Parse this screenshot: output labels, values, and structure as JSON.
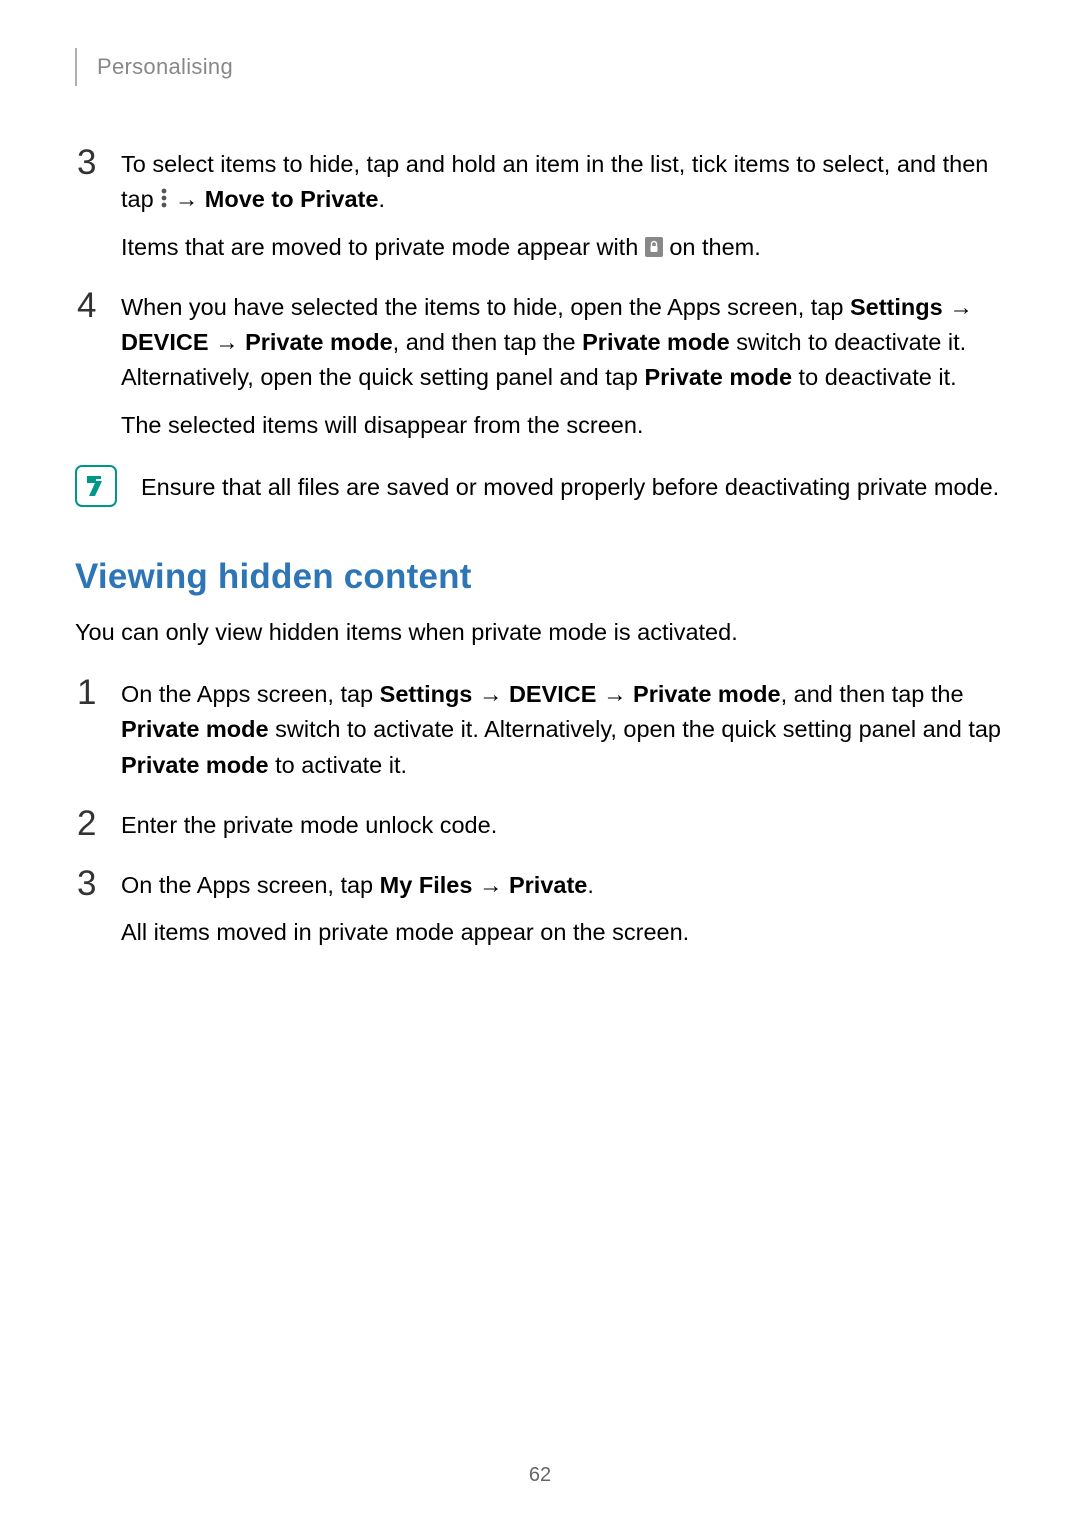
{
  "header": {
    "title": "Personalising"
  },
  "block1": {
    "step3": {
      "num": "3",
      "p1_a": "To select items to hide, tap and hold an item in the list, tick items to select, and then tap ",
      "p1_b": " → ",
      "p1_c": "Move to Private",
      "p1_d": ".",
      "p2_a": "Items that are moved to private mode appear with ",
      "p2_b": " on them."
    },
    "step4": {
      "num": "4",
      "p1_a": "When you have selected the items to hide, open the Apps screen, tap ",
      "p1_b": "Settings",
      "p1_c": " → ",
      "p1_d": "DEVICE",
      "p1_e": " → ",
      "p1_f": "Private mode",
      "p1_g": ", and then tap the ",
      "p1_h": "Private mode",
      "p1_i": " switch to deactivate it. Alternatively, open the quick setting panel and tap ",
      "p1_j": "Private mode",
      "p1_k": " to deactivate it.",
      "p2": "The selected items will disappear from the screen."
    }
  },
  "note": {
    "text": "Ensure that all files are saved or moved properly before deactivating private mode."
  },
  "section": {
    "heading": "Viewing hidden content",
    "intro": "You can only view hidden items when private mode is activated.",
    "step1": {
      "num": "1",
      "a": "On the Apps screen, tap ",
      "b": "Settings",
      "c": " → ",
      "d": "DEVICE",
      "e": " → ",
      "f": "Private mode",
      "g": ", and then tap the ",
      "h": "Private mode",
      "i": " switch to activate it. Alternatively, open the quick setting panel and tap ",
      "j": "Private mode",
      "k": " to activate it."
    },
    "step2": {
      "num": "2",
      "text": "Enter the private mode unlock code."
    },
    "step3": {
      "num": "3",
      "p1_a": "On the Apps screen, tap ",
      "p1_b": "My Files",
      "p1_c": " → ",
      "p1_d": "Private",
      "p1_e": ".",
      "p2": "All items moved in private mode appear on the screen."
    }
  },
  "page_number": "62"
}
